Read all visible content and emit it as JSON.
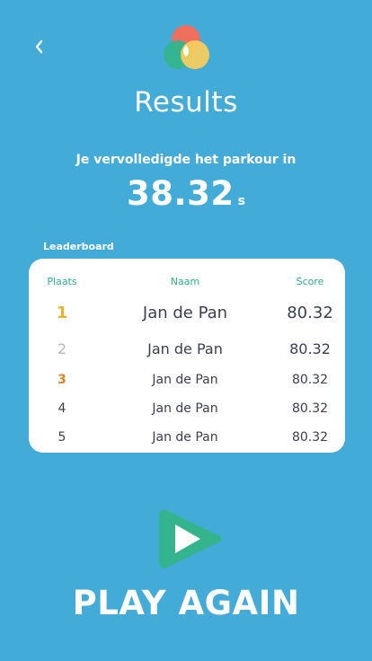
{
  "header": {
    "back_icon": "chevron-left-icon",
    "logo_icon": "colored-circles-logo",
    "title": "Results"
  },
  "result": {
    "subtitle": "Je vervolledigde het parkour in",
    "time": "38.32",
    "unit": "s"
  },
  "leaderboard": {
    "label": "Leaderboard",
    "columns": {
      "rank": "Plaats",
      "name": "Naam",
      "score": "Score"
    },
    "rows": [
      {
        "rank": "1",
        "name": "Jan de Pan",
        "score": "80.32",
        "rank_color": "#E8B32C"
      },
      {
        "rank": "2",
        "name": "Jan de Pan",
        "score": "80.32",
        "rank_color": "#B5B5B5"
      },
      {
        "rank": "3",
        "name": "Jan de Pan",
        "score": "80.32",
        "rank_color": "#D9852A"
      },
      {
        "rank": "4",
        "name": "Jan de Pan",
        "score": "80.32",
        "rank_color": "#3A3F52"
      },
      {
        "rank": "5",
        "name": "Jan de Pan",
        "score": "80.32",
        "rank_color": "#3A3F52"
      }
    ]
  },
  "play_again": {
    "icon": "play-icon",
    "label": "PLAY AGAIN"
  },
  "colors": {
    "background": "#42ABD8",
    "accent": "#2CB089",
    "text_dark": "#3A3F52"
  }
}
